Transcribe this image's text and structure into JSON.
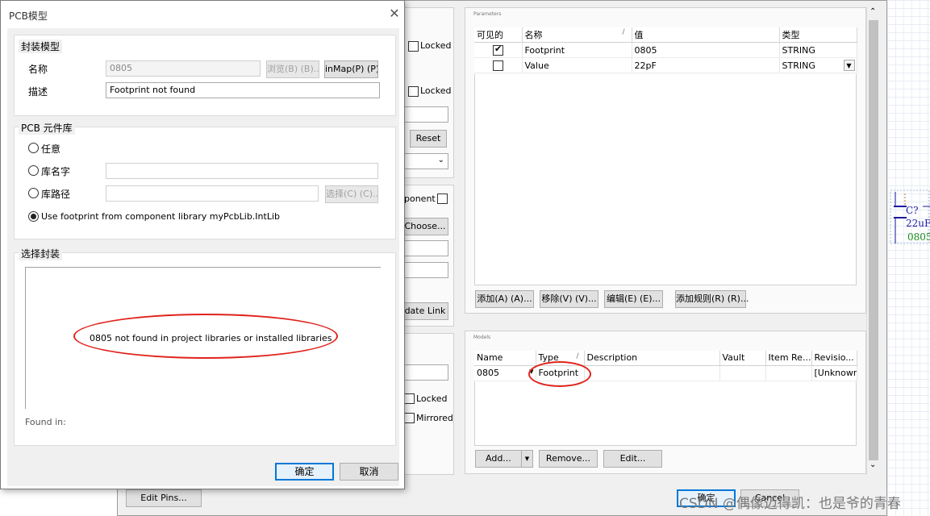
{
  "props_window": {
    "locked_1": "Locked",
    "locked_2": "Locked",
    "reset_label": "Reset",
    "component_label": "ponent",
    "choose_label": "Choose...",
    "update_link_label": "date Link",
    "locked_3": "Locked",
    "mirrored_label": "Mirrored",
    "edit_pins_label": "Edit Pins...",
    "ok_label": "确定",
    "cancel_label": "Cancel",
    "parameters": {
      "title": "Parameters",
      "columns": [
        "可见的",
        "名称",
        "值",
        "类型"
      ],
      "sort_marker": "/",
      "rows": [
        {
          "visible": true,
          "name": "Footprint",
          "value": "0805",
          "type": "STRING"
        },
        {
          "visible": false,
          "name": "Value",
          "value": "22pF",
          "type": "STRING"
        }
      ],
      "buttons": [
        "添加(A) (A)...",
        "移除(V) (V)...",
        "编辑(E) (E)...",
        "添加规则(R) (R)..."
      ]
    },
    "models": {
      "title": "Models",
      "columns": [
        "Name",
        "Type",
        "Description",
        "Vault",
        "Item Re...",
        "Revisio..."
      ],
      "sort_marker": "/",
      "rows": [
        {
          "name": "0805",
          "type": "Footprint",
          "description": "",
          "vault": "",
          "item": "",
          "revision": "[Unknowr"
        }
      ],
      "buttons": [
        "Add...",
        "Remove...",
        "Edit..."
      ]
    }
  },
  "schematic": {
    "designator": "C?",
    "value": "22uF",
    "footprint": "0805"
  },
  "pcb_dialog": {
    "title": "PCB模型",
    "footprint_model": {
      "title": "封装模型",
      "name_label": "名称",
      "name_value": "0805",
      "browse_label": "浏览(B) (B)...",
      "pinmap_label": "inMap(P) (P)...",
      "desc_label": "描述",
      "desc_value": "Footprint not found"
    },
    "pcb_library": {
      "title": "PCB 元件库",
      "any_label": "任意",
      "libname_label": "库名字",
      "libpath_label": "库路径",
      "select_label": "选择(C) (C)...",
      "use_component_lib": "Use footprint from component library myPcbLib.IntLib"
    },
    "select_footprint": {
      "title": "选择封装",
      "not_found": "0805 not found in project libraries or installed libraries",
      "found_in_label": "Found in:"
    },
    "ok_label": "确定",
    "cancel_label": "取消"
  },
  "watermark": "CSDN @偶像迈得凯：也是爷的青春",
  "colors": {
    "annotation_red": "#e0231c",
    "focus_blue": "#0078d7",
    "schematic_blue": "#1a1aa0",
    "schematic_green": "#1a8a1a"
  }
}
